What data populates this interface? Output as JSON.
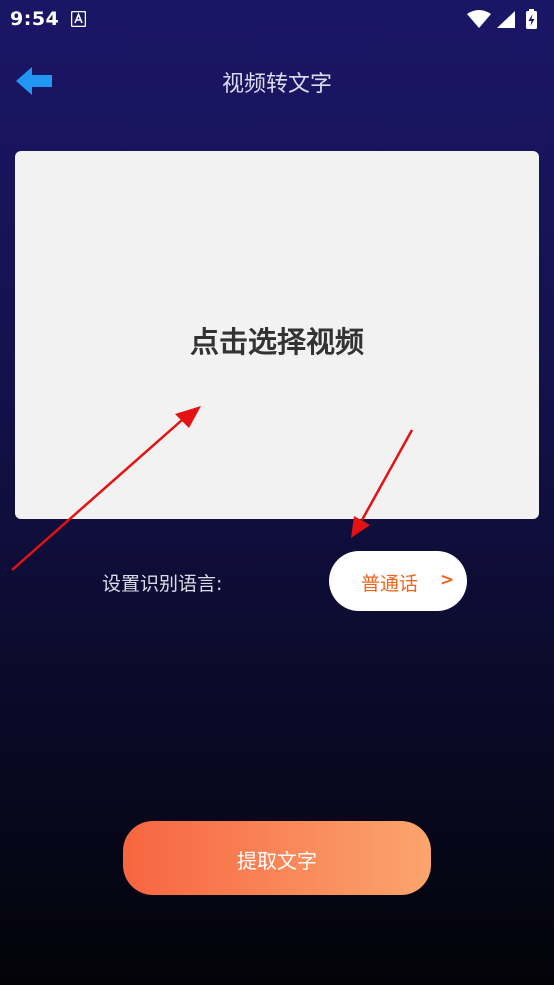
{
  "status_bar": {
    "time": "9:54",
    "icons": [
      "a-notification-icon",
      "wifi-icon",
      "signal-icon",
      "battery-charging-icon"
    ]
  },
  "header": {
    "back_icon": "back-arrow-icon",
    "title": "视频转文字"
  },
  "video_picker": {
    "label": "点击选择视频"
  },
  "language": {
    "label": "设置识别语言:",
    "value": "普通话",
    "chevron": ">"
  },
  "actions": {
    "extract_label": "提取文字"
  },
  "colors": {
    "accent_orange": "#f0641e",
    "back_arrow_blue": "#2196f3",
    "button_gradient_start": "#f86540",
    "button_gradient_end": "#fba56d",
    "annotation_arrow_red": "#e41212"
  }
}
